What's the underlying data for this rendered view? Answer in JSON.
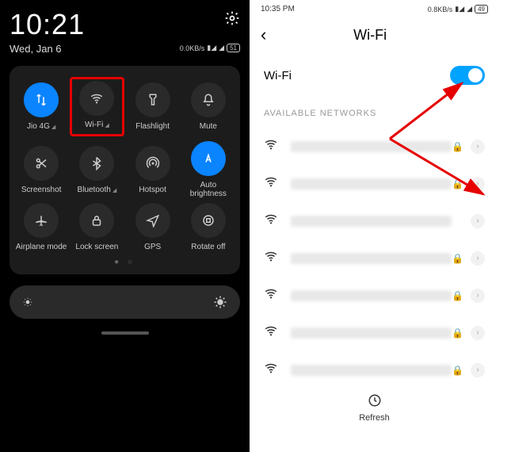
{
  "left": {
    "clock": "10:21",
    "date": "Wed, Jan 6",
    "speed": "0.0KB/s",
    "battery": "51",
    "tiles": [
      {
        "label": "Jio 4G",
        "icon": "data-arrows",
        "active": true,
        "tri": true
      },
      {
        "label": "Wi-Fi",
        "icon": "wifi",
        "active": false,
        "tri": true,
        "highlight": true
      },
      {
        "label": "Flashlight",
        "icon": "flashlight",
        "active": false
      },
      {
        "label": "Mute",
        "icon": "bell",
        "active": false
      },
      {
        "label": "Screenshot",
        "icon": "scissors",
        "active": false
      },
      {
        "label": "Bluetooth",
        "icon": "bluetooth",
        "active": false,
        "tri": true
      },
      {
        "label": "Hotspot",
        "icon": "hotspot",
        "active": false
      },
      {
        "label": "Auto brightness",
        "icon": "auto-a",
        "active": true
      },
      {
        "label": "Airplane mode",
        "icon": "plane",
        "active": false
      },
      {
        "label": "Lock screen",
        "icon": "lock",
        "active": false
      },
      {
        "label": "GPS",
        "icon": "gps",
        "active": false
      },
      {
        "label": "Rotate off",
        "icon": "rotate",
        "active": false
      }
    ]
  },
  "right": {
    "time": "10:35 PM",
    "speed": "0.8KB/s",
    "battery": "49",
    "title": "Wi-Fi",
    "toggle_label": "Wi-Fi",
    "section": "AVAILABLE NETWORKS",
    "networks": [
      {
        "locked": true
      },
      {
        "locked": true
      },
      {
        "locked": false
      },
      {
        "locked": true
      },
      {
        "locked": true
      },
      {
        "locked": true
      },
      {
        "locked": true
      }
    ],
    "refresh": "Refresh"
  }
}
